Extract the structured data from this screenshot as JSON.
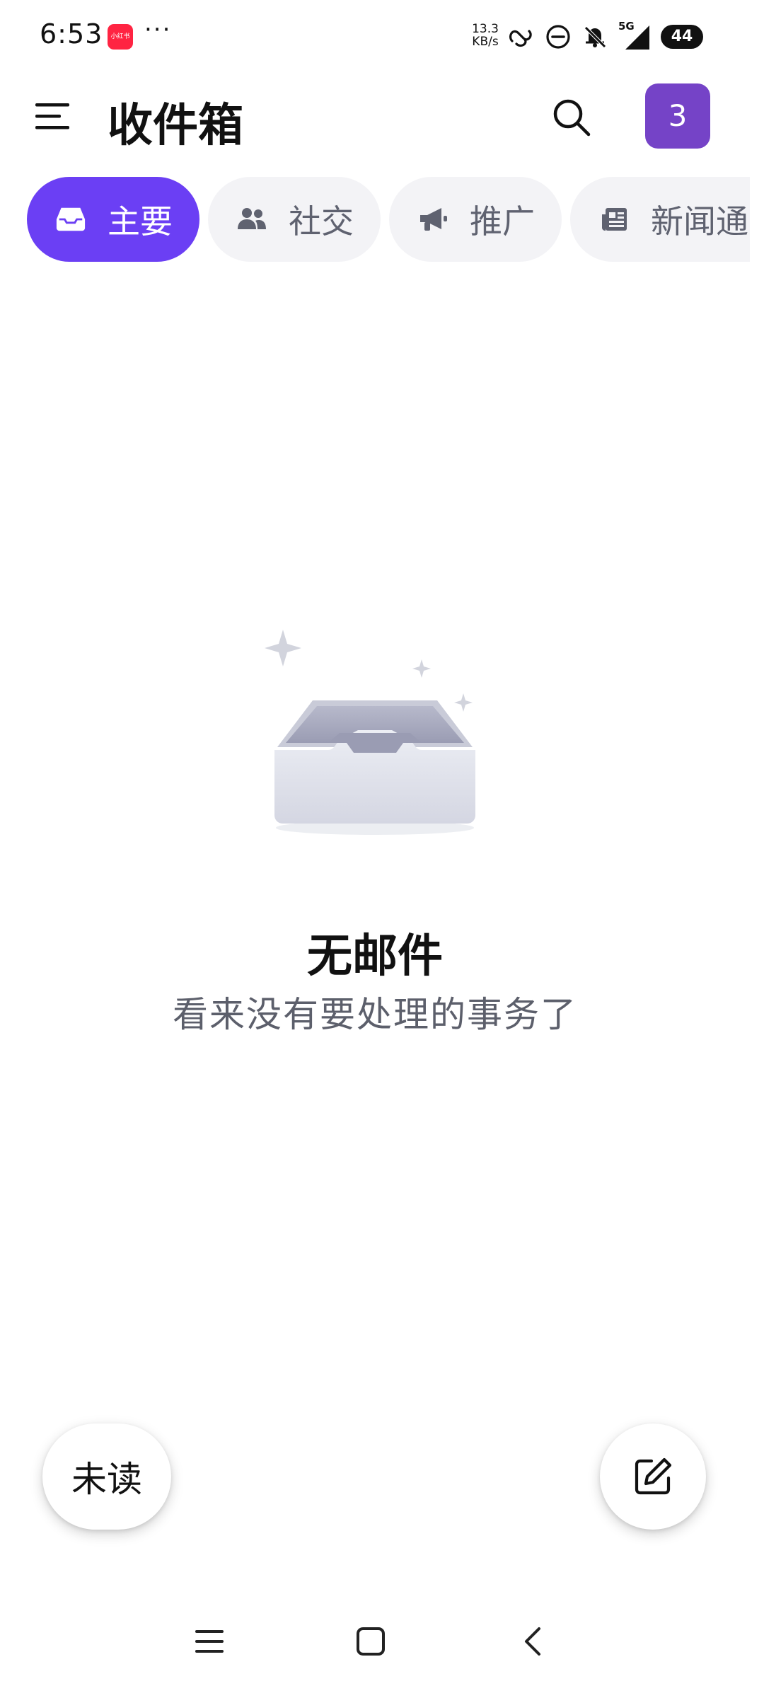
{
  "status_bar": {
    "time": "6:53",
    "app_icon_label": "小红书",
    "more": "···",
    "net_speed_value": "13.3",
    "net_speed_unit": "KB/s",
    "network": "5G",
    "battery": "44"
  },
  "header": {
    "title": "收件箱",
    "account_count": "3"
  },
  "tabs": [
    {
      "label": "主要",
      "icon": "inbox-icon",
      "active": true
    },
    {
      "label": "社交",
      "icon": "people-icon",
      "active": false
    },
    {
      "label": "推广",
      "icon": "megaphone-icon",
      "active": false
    },
    {
      "label": "新闻通",
      "icon": "newspaper-icon",
      "active": false
    }
  ],
  "empty_state": {
    "title": "无邮件",
    "subtitle": "看来没有要处理的事务了",
    "illustration": "empty-tray-illustration"
  },
  "fab": {
    "unread_label": "未读",
    "compose_icon": "compose-icon"
  },
  "colors": {
    "accent": "#6b3ff4",
    "account_badge": "#7543c7",
    "tab_inactive_bg": "#f3f3f6",
    "tab_inactive_text": "#5f6270",
    "subtitle_text": "#5c5f6b"
  }
}
